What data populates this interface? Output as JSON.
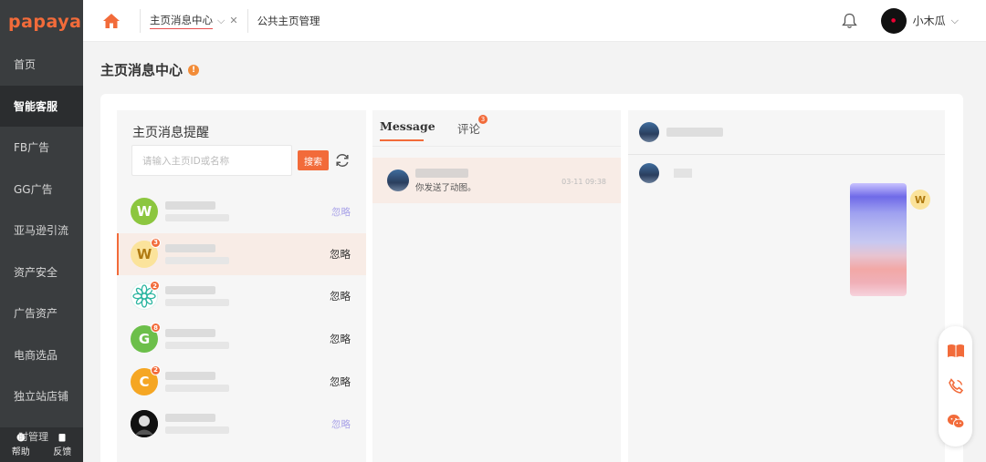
{
  "app": {
    "logo": "papaya"
  },
  "sidebar": {
    "items": [
      {
        "label": "首页",
        "active": false
      },
      {
        "label": "智能客服",
        "active": true
      },
      {
        "label": "FB广告",
        "active": false
      },
      {
        "label": "GG广告",
        "active": false
      },
      {
        "label": "亚马逊引流",
        "active": false
      },
      {
        "label": "资产安全",
        "active": false
      },
      {
        "label": "广告资产",
        "active": false
      },
      {
        "label": "电商选品",
        "active": false
      },
      {
        "label": "独立站店铺",
        "active": false
      }
    ],
    "bottom": {
      "overlay_text": "时管理",
      "help_label": "帮助",
      "feedback_label": "反馈"
    }
  },
  "topbar": {
    "tabs": [
      {
        "label": "主页消息中心",
        "active": true
      },
      {
        "label": "公共主页管理",
        "active": false
      }
    ],
    "user": {
      "name": "小木瓜"
    }
  },
  "page": {
    "title": "主页消息中心",
    "info_icon": "!"
  },
  "left_panel": {
    "title": "主页消息提醒",
    "search_placeholder": "请输入主页ID或名称",
    "search_button": "搜索",
    "rows": [
      {
        "avatar_letter": "W",
        "avatar_bg": "#8cc63f",
        "avatar_fg": "#ffffff",
        "badge": "",
        "ignore": "忽略",
        "faded": true,
        "active": false
      },
      {
        "avatar_letter": "W",
        "avatar_bg": "#fbe39b",
        "avatar_fg": "#b07a10",
        "badge": "3",
        "ignore": "忽略",
        "faded": false,
        "active": true
      },
      {
        "avatar_letter": "",
        "avatar_bg": "#ffffff",
        "avatar_fg": "#2bb5a0",
        "badge": "2",
        "ignore": "忽略",
        "faded": false,
        "active": false,
        "icon": "flower-icon"
      },
      {
        "avatar_letter": "G",
        "avatar_bg": "#6cbf4a",
        "avatar_fg": "#ffffff",
        "badge": "8",
        "ignore": "忽略",
        "faded": false,
        "active": false
      },
      {
        "avatar_letter": "C",
        "avatar_bg": "#f5a623",
        "avatar_fg": "#ffffff",
        "badge": "2",
        "ignore": "忽略",
        "faded": false,
        "active": false
      },
      {
        "avatar_letter": "",
        "avatar_bg": "#111111",
        "avatar_fg": "#ffffff",
        "badge": "",
        "ignore": "忽略",
        "faded": true,
        "active": false,
        "icon": "photo-avatar-icon"
      }
    ]
  },
  "middle_panel": {
    "tabs": [
      {
        "label": "Message",
        "badge": ""
      },
      {
        "label": "评论",
        "badge": "3"
      }
    ],
    "conversation": {
      "preview": "你发送了动图。",
      "time": "03-11 09:38"
    }
  },
  "colors": {
    "accent": "#f26b3a",
    "sidebar_bg": "#3a3d3f"
  }
}
